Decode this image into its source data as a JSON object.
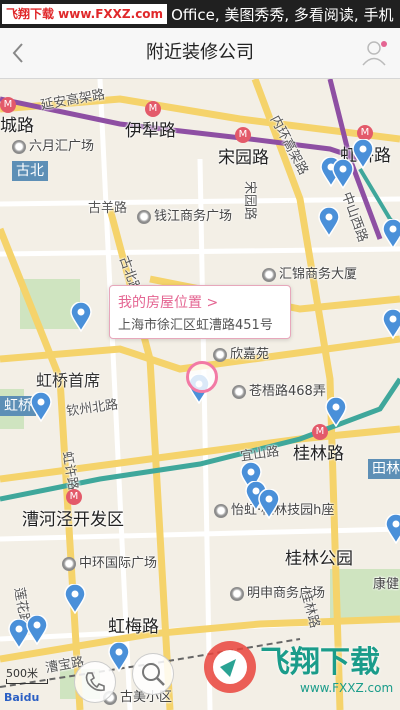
{
  "status_bar": {
    "watermark": "飞翔下载 www.FXXZ.com",
    "text": "Office, 美图秀秀, 多看阅读, 手机"
  },
  "header": {
    "back_icon": "chevron-left-icon",
    "title": "附近装修公司",
    "user_icon": "user-avatar-icon"
  },
  "map": {
    "place_labels": [
      {
        "text": "城路"
      },
      {
        "text": "伊犁路"
      },
      {
        "text": "宋园路"
      },
      {
        "text": "虹桥路"
      },
      {
        "text": "古北"
      },
      {
        "text": "虹桥首席"
      },
      {
        "text": "虹桥"
      },
      {
        "text": "桂林路"
      },
      {
        "text": "漕河泾开发区"
      },
      {
        "text": "桂林公园"
      },
      {
        "text": "虹梅路"
      },
      {
        "text": "田林"
      },
      {
        "text": "康健"
      }
    ],
    "poi_labels": [
      {
        "text": "六月汇广场"
      },
      {
        "text": "钱江商务广场"
      },
      {
        "text": "汇锦商务大厦"
      },
      {
        "text": "欣嘉苑"
      },
      {
        "text": "苍梧路468弄"
      },
      {
        "text": "怡虹·桂林技园h座"
      },
      {
        "text": "中环国际广场"
      },
      {
        "text": "明申商务广场"
      },
      {
        "text": "古美小区"
      }
    ],
    "road_labels": [
      {
        "text": "延安高架路"
      },
      {
        "text": "内环高架路"
      },
      {
        "text": "古羊路"
      },
      {
        "text": "宋园路"
      },
      {
        "text": "古北路"
      },
      {
        "text": "钦州北路"
      },
      {
        "text": "宜山路"
      },
      {
        "text": "虹许路"
      },
      {
        "text": "中山西路"
      },
      {
        "text": "桂林路"
      },
      {
        "text": "漕宝路"
      },
      {
        "text": "莲花路"
      }
    ],
    "callout": {
      "title": "我的房屋位置 >",
      "address": "上海市徐汇区虹漕路451号"
    },
    "scale_text": "500米",
    "logo_text": "Baidu",
    "buttons": [
      {
        "icon": "phone-icon"
      },
      {
        "icon": "search-icon"
      }
    ],
    "watermark": {
      "brand": "飞翔下载",
      "url": "www.FXXZ.com"
    },
    "colors": {
      "highway": "#f5d36b",
      "metro_line_purple": "#8e4fa3",
      "metro_line_teal": "#3fa79b",
      "pin_blue": "#4a90d9",
      "callout_pink": "#e46592"
    }
  }
}
